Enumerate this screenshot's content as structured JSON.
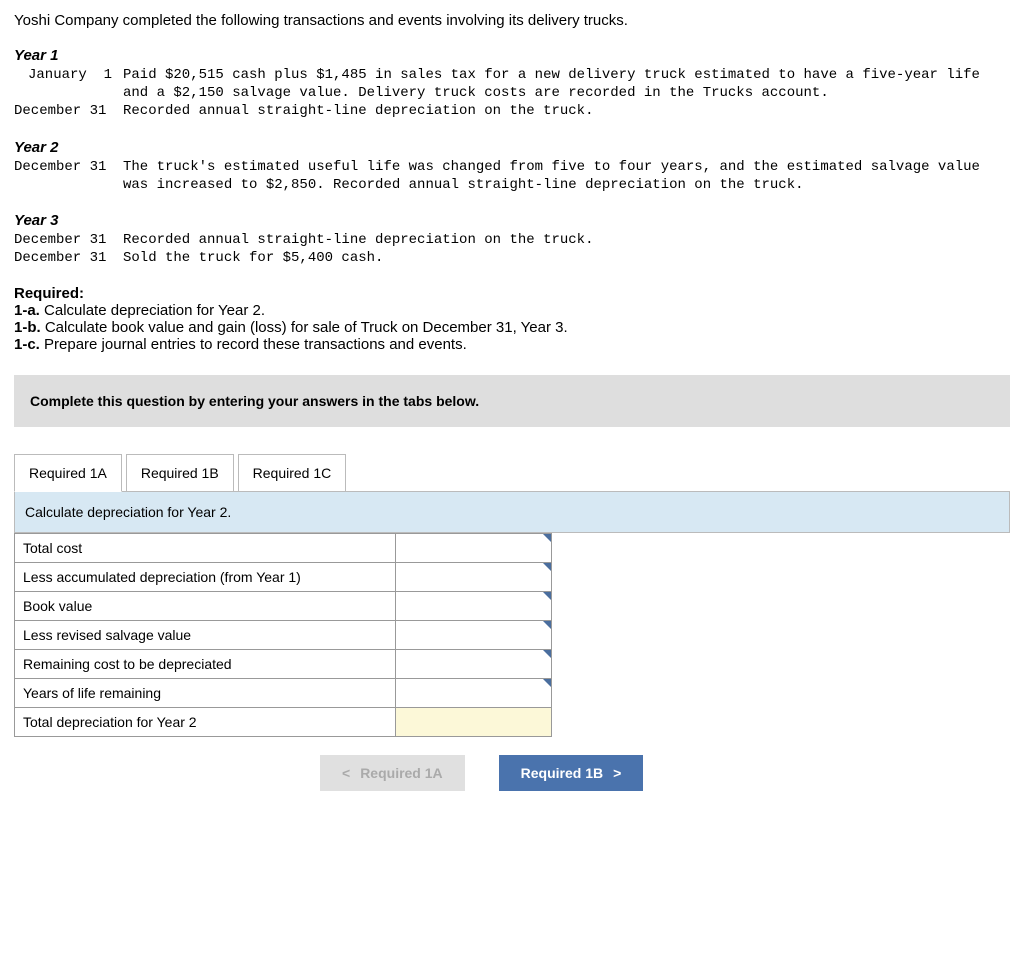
{
  "intro": "Yoshi Company completed the following transactions and events involving its delivery trucks.",
  "year1": {
    "heading": "Year 1",
    "jan1_date": "January  1",
    "jan1_text": "Paid $20,515 cash plus $1,485 in sales tax for a new delivery truck estimated to have a five-year life and a $2,150 salvage value. Delivery truck costs are recorded in the Trucks account.",
    "dec31_date": "December 31",
    "dec31_text": "Recorded annual straight-line depreciation on the truck."
  },
  "year2": {
    "heading": "Year 2",
    "dec31_date": "December 31",
    "dec31_text": "The truck's estimated useful life was changed from five to four years, and the estimated salvage value was increased to $2,850. Recorded annual straight-line depreciation on the truck."
  },
  "year3": {
    "heading": "Year 3",
    "dec31a_date": "December 31",
    "dec31a_text": "Recorded annual straight-line depreciation on the truck.",
    "dec31b_date": "December 31",
    "dec31b_text": "Sold the truck for $5,400 cash."
  },
  "required": {
    "title": "Required:",
    "a_label": "1-a.",
    "a_text": " Calculate depreciation for Year 2.",
    "b_label": "1-b.",
    "b_text": " Calculate book value and gain (loss) for sale of Truck on December 31, Year 3.",
    "c_label": "1-c.",
    "c_text": " Prepare journal entries to record these transactions and events."
  },
  "gray_box": "Complete this question by entering your answers in the tabs below.",
  "tabs": {
    "t1": "Required 1A",
    "t2": "Required 1B",
    "t3": "Required 1C"
  },
  "tab_header": "Calculate depreciation for Year 2.",
  "rows": {
    "r1": "Total cost",
    "r2": "Less accumulated depreciation (from Year 1)",
    "r3": "Book value",
    "r4": "Less revised salvage value",
    "r5": "Remaining cost to be depreciated",
    "r6": "Years of life remaining",
    "r7": "Total depreciation for Year 2"
  },
  "nav": {
    "prev": "Required 1A",
    "next": "Required 1B"
  }
}
